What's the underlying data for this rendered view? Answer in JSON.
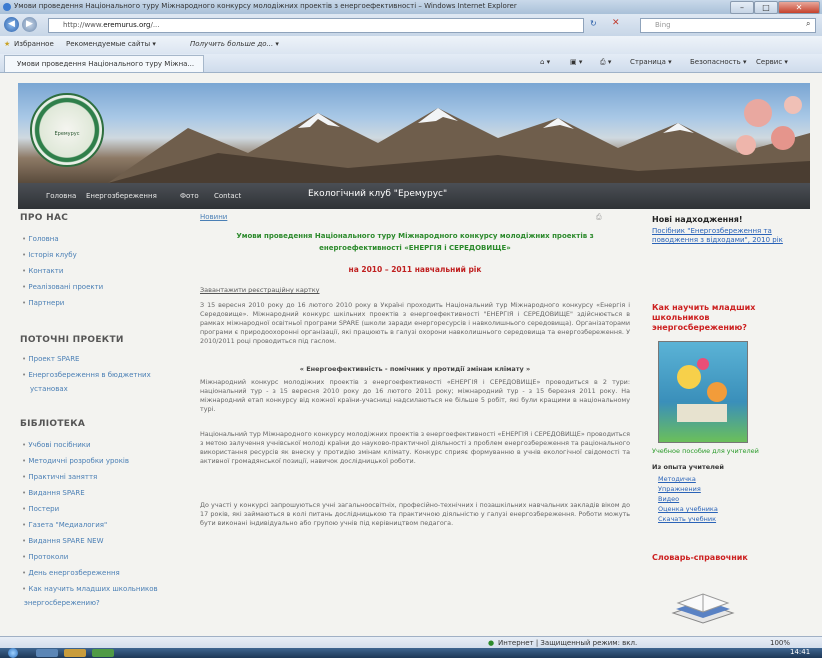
{
  "window": {
    "title": "Умови проведення Національного туру Міжнародного конкурсу молодіжних проектів з енергоефективності – Windows Internet Explorer",
    "controls": {
      "minimize": "–",
      "maximize": "□",
      "close": "✕"
    }
  },
  "address_bar": {
    "url_prefix": "http://www.",
    "url_domain": "eremurus.org",
    "url_rest": "/...",
    "search_placeholder": "Bing"
  },
  "favorites_bar": {
    "favorites_label": "Избранное",
    "suggested_sites": "Рекомендуемые сайты ▾",
    "get_more": "Получить больше до... ▾"
  },
  "tab": {
    "title": "Умови проведення Національного туру Міжна...",
    "commands": {
      "page": "Страница ▾",
      "safety": "Безопасность ▾",
      "service": "Сервис ▾"
    }
  },
  "site": {
    "nav": [
      "Головна",
      "Енергозбереження",
      "Фото",
      "Contact"
    ],
    "club_name": "Екологічний клуб \"Еремурус\"",
    "logo_text": "Еремурус"
  },
  "sidebar": {
    "about_heading": "ПРО НАС",
    "about_items": [
      "Головна",
      "Історія клубу",
      "Контакти",
      "Реалізовані проекти",
      "Партнери"
    ],
    "current_heading": "ПОТОЧНІ ПРОЕКТИ",
    "current_items": [
      "Проект SPARE",
      "Енергозбереження в бюджетних",
      "установах"
    ],
    "library_heading": "БІБЛІОТЕКА",
    "library_items": [
      "Учбові посібники",
      "Методичні розробки уроків",
      "Практичні заняття",
      "Видання SPARE",
      "Постери",
      "Газета \"Медиалогия\"",
      "Видання SPARE NEW",
      "Протоколи",
      "День енергозбереження",
      "Как научить младших школьников",
      "энергосбережению?"
    ]
  },
  "main": {
    "breadcrumb": "Новини",
    "title_line1": "Умови проведення Національного туру Міжнародного конкурсу молодіжних проектів з",
    "title_line2": "енергоефективності «ЕНЕРГІЯ і СЕРЕДОВИЩЕ»",
    "year_line": "на 2010 – 2011 навчальний рік",
    "reg_link": "Завантажити реєстраційну картку",
    "para1": "З 15 вересня 2010 року до 16 лютого 2010 року в Україні проходить Національний тур Міжнародного конкурсу «Енергія і Середовище». Міжнародний конкурс шкільних проектів з енергоефективності \"ЕНЕРГІЯ і СЕРЕДОВИЩЕ\" здійснюється в рамках міжнародної освітньої програми SPARE (школи заради енергоресурсів і навколишнього середовища). Організаторами програми є природоохоронні організації, які працюють в галузі охорони навколишнього середовища та енергозбереження. У 2010/2011 році проводиться під гаслом.",
    "quote": "« Енергоефективність - помічник у протидії змінам клімату »",
    "para2": "Міжнародний конкурс молодіжних проектів з енергоефективності «ЕНЕРГІЯ і СЕРЕДОВИЩЕ» проводиться в 2 тури: національний тур - з 15 вересня 2010 року до 16 лютого 2011 року; міжнародний тур - з 15 березня 2011 року. На міжнародний етап конкурсу від кожної країни-учасниці надсилаються не більше 5 робіт, які були кращими в національному турі.",
    "para3": "Національний тур Міжнародного конкурсу молодіжних проектів з енергоефективності «ЕНЕРГІЯ і СЕРЕДОВИЩЕ» проводиться з метою залучення учнівської молоді країни до науково-практичної діяльності з проблем енергозбереження та раціонального використання ресурсів як внеску у протидію змінам клімату. Конкурс сприяє формуванню в учнів екологічної свідомості та активної громадянської позиції, навичок дослідницької роботи.",
    "para4": "До участі у конкурсі запрошуються учні загальноосвітніх, професійно-технічних і позашкільних навчальних закладів віком до 17 років, які займаються в колі питань дослідницькою та практичною діяльністю у галузі енергозбереження. Роботи можуть бути виконані індивідуально або групою учнів під керівництвом педагога."
  },
  "right": {
    "news_heading": "Нові надходження!",
    "news_link": "Посібник \"Енергозбереження та поводження з відходами\", 2010 рік",
    "teach_heading": "Как научить младших школьников энергосбережению?",
    "teach_caption": "Учебное пособие для учителей",
    "teach_sub": "Из опыта учителей",
    "teach_links": [
      "Методичка",
      "Упражнения",
      "Видео",
      "Оценка учебника",
      "Скачать учебник"
    ],
    "dict_heading": "Словарь-справочник"
  },
  "status_bar": {
    "zone": "Интернет | Защищенный режим: вкл.",
    "zoom": "100%"
  },
  "taskbar": {
    "clock": "14:41"
  }
}
